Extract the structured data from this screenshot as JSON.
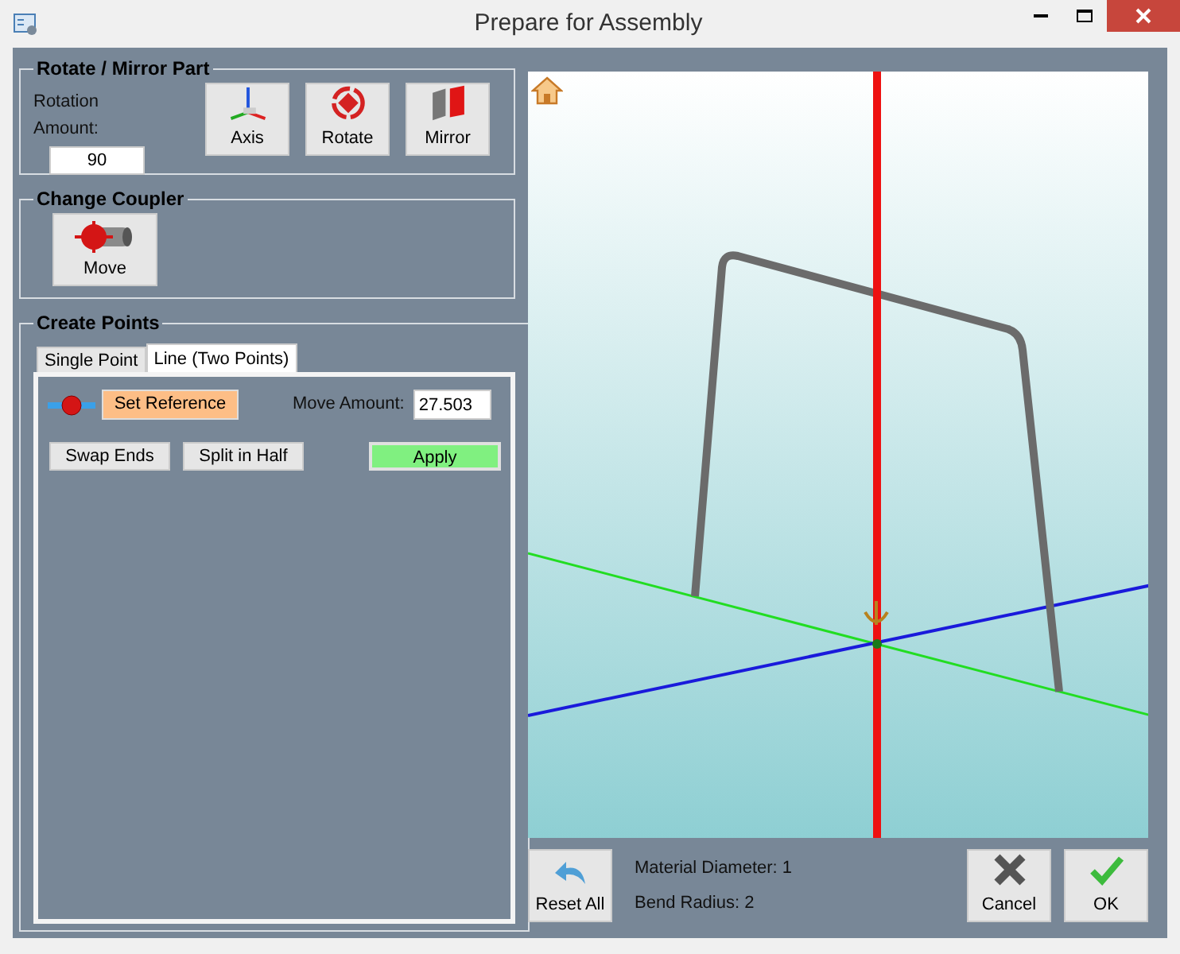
{
  "window": {
    "title": "Prepare for Assembly"
  },
  "rotate_group": {
    "title": "Rotate / Mirror Part",
    "rotation_label": "Rotation Amount:",
    "rotation_value": "90",
    "buttons": [
      {
        "kind": "axis",
        "label": "Axis"
      },
      {
        "kind": "rotate",
        "label": "Rotate"
      },
      {
        "kind": "mirror",
        "label": "Mirror"
      }
    ]
  },
  "coupler_group": {
    "title": "Change Coupler",
    "button": {
      "label": "Move"
    }
  },
  "points_group": {
    "title": "Create Points",
    "tabs": [
      {
        "label": "Single Point",
        "selected": false
      },
      {
        "label": "Line (Two Points)",
        "selected": true
      }
    ],
    "set_reference": "Set Reference",
    "move_label": "Move Amount:",
    "move_value": "27.503",
    "buttons": [
      {
        "kind": "plain",
        "label": "Swap Ends"
      },
      {
        "kind": "plain",
        "label": "Split in Half"
      },
      {
        "kind": "apply",
        "label": "Apply"
      }
    ]
  },
  "footer": {
    "reset": "Reset All",
    "info": [
      "Material Diameter: 1",
      "Bend Radius: 2"
    ],
    "cancel": "Cancel",
    "ok": "OK"
  }
}
